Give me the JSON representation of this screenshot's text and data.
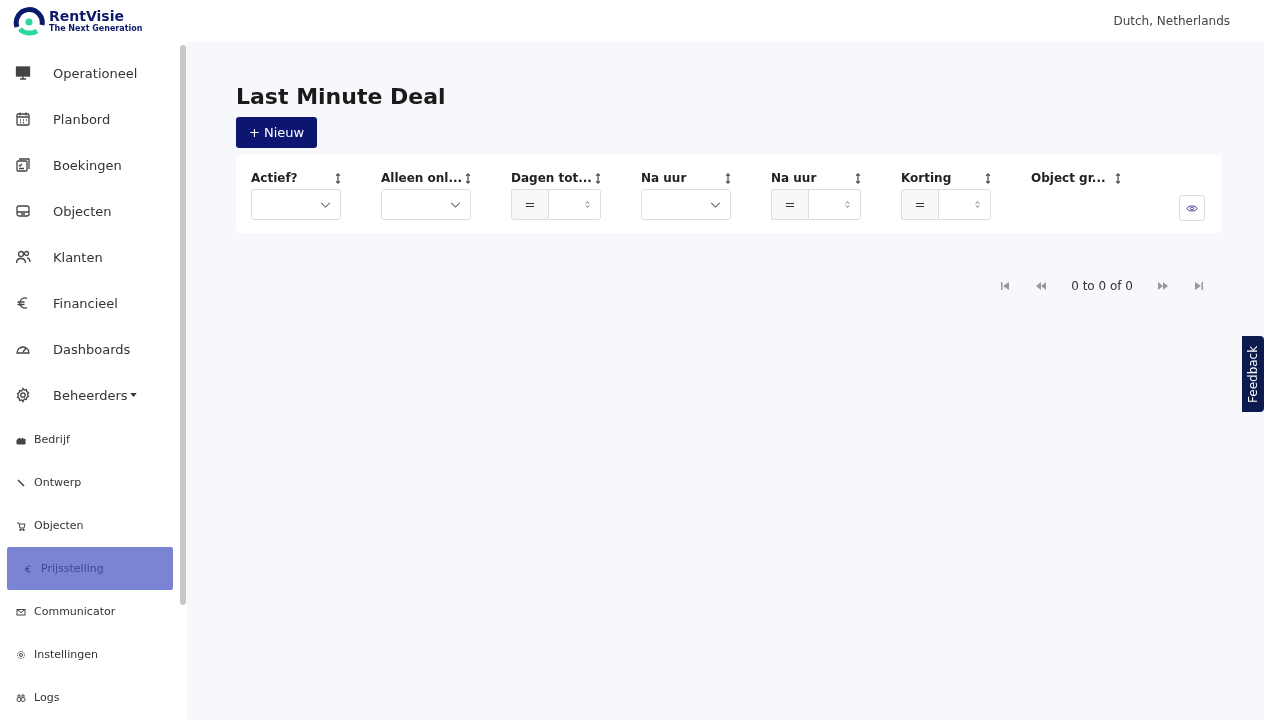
{
  "logo": {
    "name": "RentVisie",
    "tagline": "The Next Generation"
  },
  "header": {
    "language": "Dutch, Netherlands"
  },
  "sidebar": {
    "items": [
      {
        "label": "Operationeel",
        "selected": false
      },
      {
        "label": "Planbord",
        "selected": false
      },
      {
        "label": "Boekingen",
        "selected": false
      },
      {
        "label": "Objecten",
        "selected": false
      },
      {
        "label": "Klanten",
        "selected": false
      },
      {
        "label": "Financieel",
        "selected": false
      },
      {
        "label": "Dashboards",
        "selected": false
      },
      {
        "label": "Beheerders",
        "selected": false,
        "expanded": true,
        "children": [
          {
            "label": "Bedrijf",
            "selected": false
          },
          {
            "label": "Ontwerp",
            "selected": false
          },
          {
            "label": "Objecten",
            "selected": false
          },
          {
            "label": "Prijsstelling",
            "selected": true
          },
          {
            "label": "Communicator",
            "selected": false
          },
          {
            "label": "Instellingen",
            "selected": false
          },
          {
            "label": "Logs",
            "selected": false
          }
        ]
      }
    ]
  },
  "page": {
    "title": "Last Minute Deal",
    "new_button": "+ Nieuw"
  },
  "table": {
    "columns": [
      {
        "label": "Actief?",
        "kind": "select"
      },
      {
        "label": "Alleen onl...",
        "kind": "select"
      },
      {
        "label": "Dagen tot...",
        "kind": "number",
        "operator": "="
      },
      {
        "label": "Na uur",
        "kind": "select"
      },
      {
        "label": "Na uur",
        "kind": "number",
        "operator": "="
      },
      {
        "label": "Korting",
        "kind": "number",
        "operator": "="
      },
      {
        "label": "Object gr...",
        "kind": "none"
      }
    ]
  },
  "pagination": {
    "summary": "0 to 0 of 0"
  },
  "feedback_tab": "Feedback"
}
